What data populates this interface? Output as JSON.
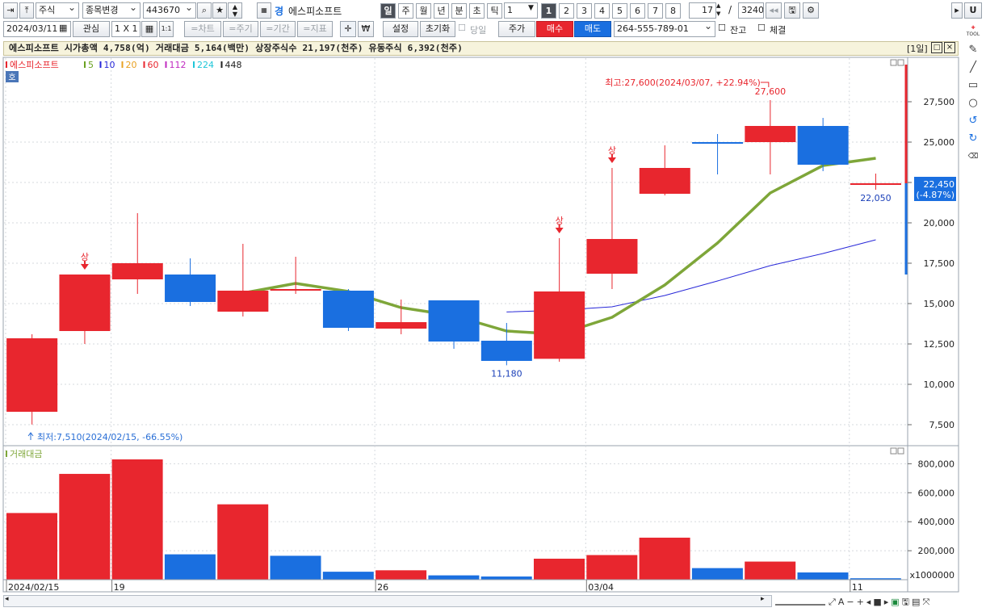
{
  "toolbar1": {
    "market": "주식",
    "stock_change": "종목변경",
    "code": "443670",
    "name_prefix": "경",
    "stock_name": "에스피소프트",
    "periods": [
      "일",
      "주",
      "월",
      "년",
      "분",
      "초",
      "틱"
    ],
    "interval_value": "1",
    "number_buttons": [
      "1",
      "2",
      "3",
      "4",
      "5",
      "6",
      "7",
      "8"
    ],
    "count_value": "17",
    "slash": "/",
    "total_value": "3240",
    "right_u": "U"
  },
  "toolbar2": {
    "date": "2024/03/11",
    "watch": "관심",
    "grid": "1 X 1",
    "one_one": "1:1",
    "chart": "=차트",
    "cycle": "=주기",
    "period": "=기간",
    "indicator": "=지표",
    "won": "₩",
    "settings": "설정",
    "reset": "초기화",
    "same_day": "당일",
    "price": "주가",
    "buy": "매수",
    "sell": "매도",
    "account": "264-555-789-01",
    "balance": "잔고",
    "fill": "체결"
  },
  "infobar": {
    "text": "에스피소프트  시가총액 4,758(억)  거래대금 5,164(백만)  상장주식수 21,197(천주)  유동주식 6,392(천주)",
    "period_tag": "[1일]"
  },
  "legend": {
    "name": "에스피소프트",
    "items": [
      {
        "label": "5",
        "color": "#6aa121"
      },
      {
        "label": "10",
        "color": "#2727d8"
      },
      {
        "label": "20",
        "color": "#e8a020"
      },
      {
        "label": "60",
        "color": "#e8262e"
      },
      {
        "label": "112",
        "color": "#c02bc0"
      },
      {
        "label": "224",
        "color": "#1ec6d8"
      },
      {
        "label": "448",
        "color": "#222222"
      }
    ],
    "badge": "호"
  },
  "chart_data": {
    "type": "candlestick",
    "dates": [
      "2024/02/15",
      "2024/02/16",
      "2024/02/19",
      "2024/02/20",
      "2024/02/21",
      "2024/02/22",
      "2024/02/23",
      "2024/02/26",
      "2024/02/27",
      "2024/02/28",
      "2024/02/29",
      "2024/03/04",
      "2024/03/05",
      "2024/03/06",
      "2024/03/07",
      "2024/03/08",
      "2024/03/11"
    ],
    "open": [
      8300,
      13300,
      16500,
      16800,
      14500,
      15800,
      15800,
      13450,
      15200,
      12700,
      11580,
      16850,
      21800,
      25000,
      25000,
      26000,
      22450
    ],
    "high": [
      13100,
      16800,
      20600,
      17800,
      18700,
      17900,
      15900,
      15250,
      15050,
      13800,
      19050,
      23400,
      24800,
      25500,
      27600,
      26500,
      23050
    ],
    "low": [
      7510,
      12500,
      15600,
      14850,
      14200,
      15600,
      13300,
      13100,
      12200,
      11180,
      11400,
      15900,
      21700,
      23000,
      23000,
      23200,
      22050
    ],
    "close": [
      12850,
      16800,
      17500,
      15100,
      15800,
      15900,
      13500,
      13850,
      12650,
      11450,
      15750,
      19000,
      23400,
      24900,
      26000,
      23600,
      22450
    ],
    "ma5": [
      null,
      null,
      null,
      null,
      15650,
      16250,
      15750,
      14750,
      14250,
      13300,
      13100,
      14150,
      16150,
      18750,
      21850,
      23550,
      24000
    ],
    "ma10": [
      null,
      null,
      null,
      null,
      null,
      null,
      null,
      null,
      null,
      14480,
      14590,
      14800,
      15500,
      16400,
      17350,
      18100,
      18950
    ],
    "volume": [
      460000,
      730000,
      830000,
      175000,
      520000,
      165000,
      55000,
      65000,
      30000,
      22000,
      145000,
      170000,
      290000,
      80000,
      125000,
      50000,
      10000
    ],
    "vol_up": [
      true,
      true,
      true,
      false,
      true,
      false,
      false,
      true,
      false,
      false,
      true,
      true,
      true,
      false,
      true,
      false,
      false
    ],
    "limit_up_days": [
      1,
      10,
      11
    ],
    "limit_up_label": "상",
    "annotations": {
      "high_note": "최고:27,600(2024/03/07, +22.94%)",
      "high_value": "27,600",
      "low_note": "최저:7,510(2024/02/15, -66.55%)",
      "low_value": "11,180",
      "last_low": "22,050",
      "current_price": "22,450",
      "current_change": "(-4.87%)"
    },
    "price_ticks": [
      "27,500",
      "25,000",
      "22,500",
      "20,000",
      "17,500",
      "15,000",
      "12,500",
      "10,000",
      "7,500"
    ],
    "price_tick_values": [
      27500,
      25000,
      22500,
      20000,
      17500,
      15000,
      12500,
      10000,
      7500
    ],
    "volume_ticks": [
      "800,000",
      "600,000",
      "400,000",
      "200,000"
    ],
    "volume_tick_values": [
      800000,
      600000,
      400000,
      200000
    ],
    "volume_unit": "x1000000",
    "volume_label": "거래대금",
    "date_labels": [
      {
        "index": 0,
        "text": "2024/02/15"
      },
      {
        "index": 2,
        "text": "19"
      },
      {
        "index": 7,
        "text": "26"
      },
      {
        "index": 11,
        "text": "03/04"
      },
      {
        "index": 16,
        "text": "11"
      }
    ],
    "price_range": [
      6500,
      30000
    ],
    "volume_range": [
      0,
      880000
    ]
  },
  "colors": {
    "up": "#e8262e",
    "down": "#1a6fe0",
    "ma5": "#7ea639",
    "ma10": "#2727d8",
    "buy": "#e8262e",
    "sell": "#1a6fe0"
  }
}
